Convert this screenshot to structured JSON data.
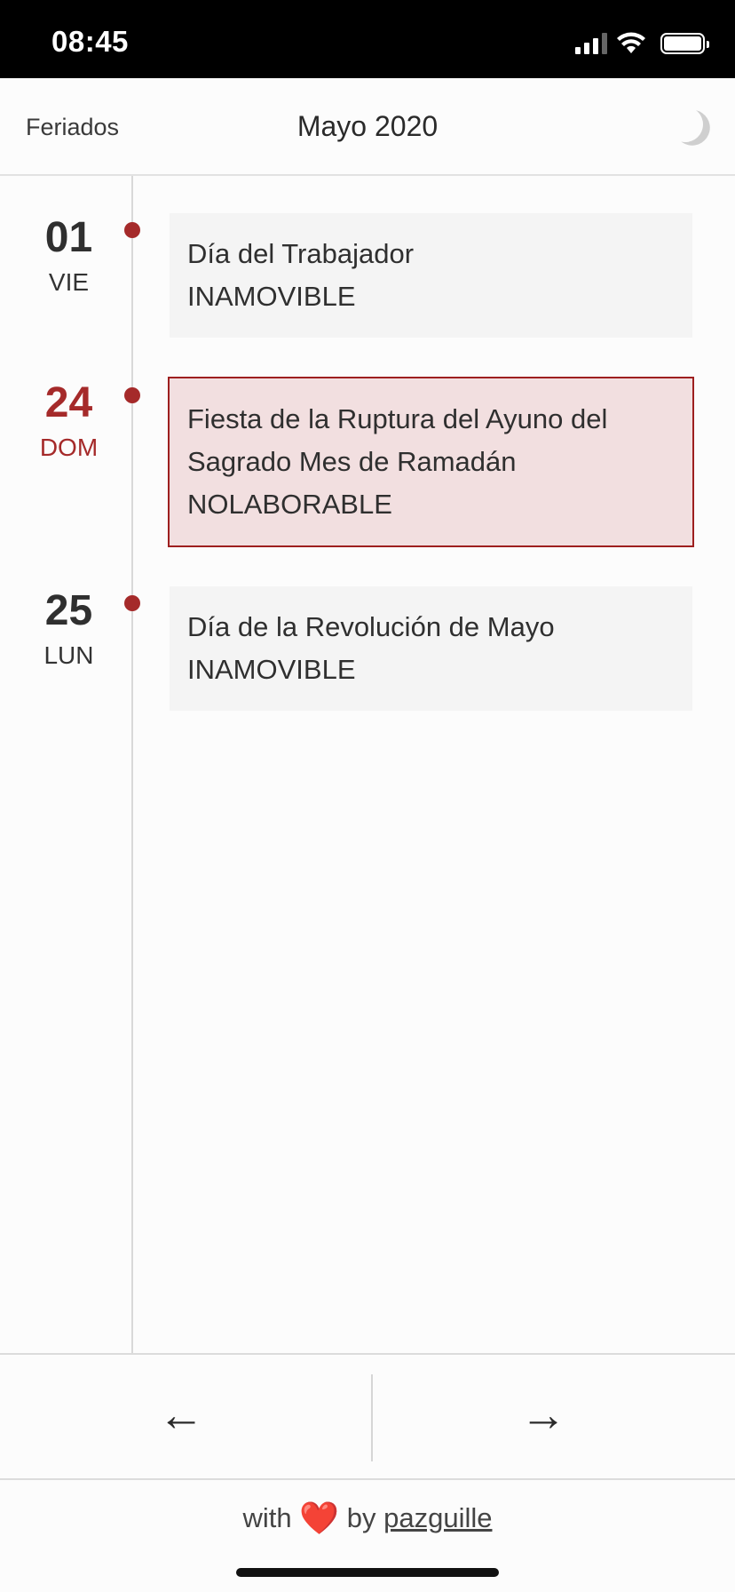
{
  "status_bar": {
    "time": "08:45"
  },
  "header": {
    "left_label": "Feriados",
    "title": "Mayo 2020",
    "theme_icon": "moon-icon"
  },
  "holidays": [
    {
      "day": "01",
      "weekday": "VIE",
      "name": "Día del Trabajador",
      "type": "INAMOVIBLE",
      "highlighted": false
    },
    {
      "day": "24",
      "weekday": "DOM",
      "name": "Fiesta de la Ruptura del Ayuno del Sagrado Mes de Ramadán",
      "type": "NOLABORABLE",
      "highlighted": true
    },
    {
      "day": "25",
      "weekday": "LUN",
      "name": "Día de la Revolución de Mayo",
      "type": "INAMOVIBLE",
      "highlighted": false
    }
  ],
  "nav": {
    "prev": "←",
    "next": "→"
  },
  "footer": {
    "with": "with",
    "heart": "❤️",
    "by": "by",
    "author": "pazguille"
  },
  "colors": {
    "accent": "#a52a2a",
    "highlight_bg": "#f2dfe0",
    "card_bg": "#f4f4f4"
  }
}
